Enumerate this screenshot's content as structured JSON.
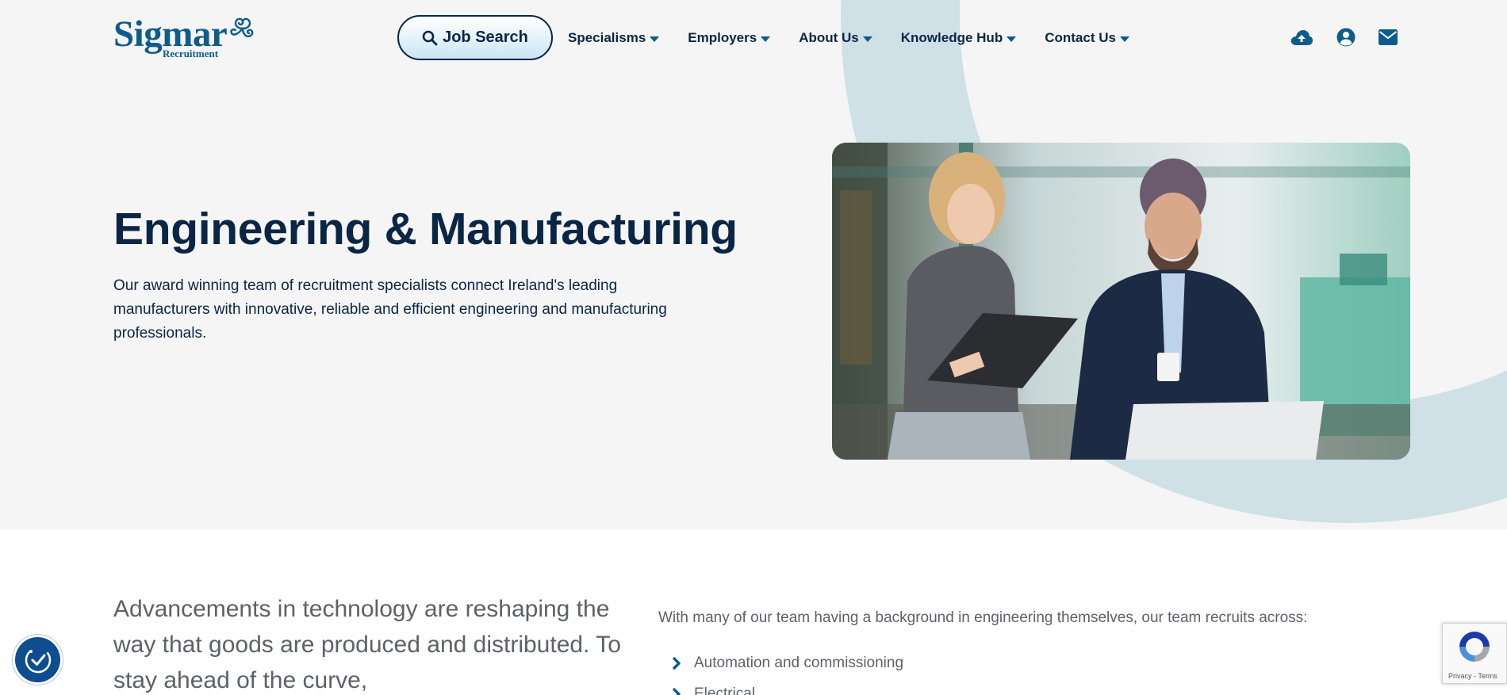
{
  "brand": {
    "name": "Sigmar",
    "tagline": "Recruitment"
  },
  "header": {
    "job_search_label": "Job Search",
    "nav": [
      {
        "label": "Specialisms"
      },
      {
        "label": "Employers"
      },
      {
        "label": "About Us"
      },
      {
        "label": "Knowledge Hub"
      },
      {
        "label": "Contact Us"
      }
    ],
    "icons": [
      "cloud-upload-icon",
      "user-account-icon",
      "envelope-icon"
    ]
  },
  "hero": {
    "title": "Engineering & Manufacturing",
    "description": "Our award winning team of recruitment specialists connect Ireland's leading manufacturers with innovative, reliable and efficient engineering and manufacturing professionals."
  },
  "intro": {
    "text": "Advancements in technology are reshaping the way that goods are produced and distributed. To stay ahead of the curve,"
  },
  "team": {
    "text": "With many of our team having a background in engineering themselves, our team recruits across:",
    "specialties": [
      "Automation and commissioning",
      "Electrical"
    ]
  },
  "recaptcha": {
    "privacy": "Privacy",
    "separator": " - ",
    "terms": "Terms"
  },
  "colors": {
    "navy": "#0b2545",
    "brand_blue": "#0d5c8a",
    "hero_background": "#f5f5f5",
    "arc": "#cfe0e7",
    "body_text": "#5d6168",
    "accessibility": "#0e4d8f"
  }
}
